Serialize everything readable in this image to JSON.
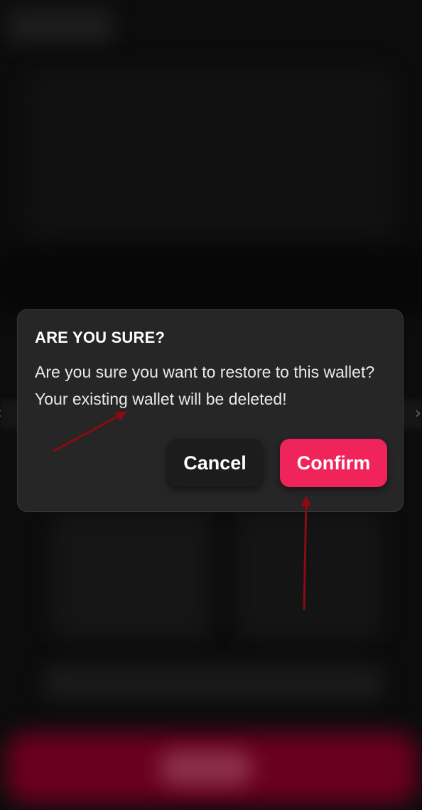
{
  "dialog": {
    "title": "ARE YOU SURE?",
    "message": "Are you sure you want to restore to this wallet? Your existing wallet will be deleted!",
    "cancel_label": "Cancel",
    "confirm_label": "Confirm"
  },
  "navigation": {
    "prev_icon": "chevron-left-icon",
    "next_icon": "chevron-right-icon",
    "prev_glyph": "‹",
    "next_glyph": "›"
  },
  "colors": {
    "dialog_background": "#262626",
    "confirm_accent": "#f0245a",
    "cancel_background": "#1c1c1c",
    "annotation_arrow": "#8b0a14"
  }
}
